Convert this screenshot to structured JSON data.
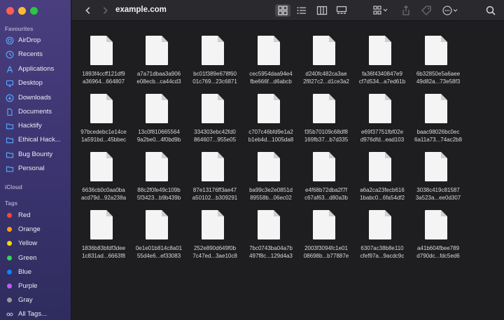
{
  "window": {
    "title": "example.com",
    "back_icon": "chevron-left-icon",
    "forward_icon": "chevron-right-icon"
  },
  "toolbar": {
    "icons": [
      "grid-view-icon",
      "list-view-icon",
      "column-view-icon",
      "gallery-view-icon",
      "group-icon",
      "share-icon",
      "tag-icon",
      "more-icon",
      "search-icon"
    ]
  },
  "sidebar": {
    "favourites_label": "Favourites",
    "favourites": [
      {
        "label": "AirDrop",
        "icon": "airdrop-icon"
      },
      {
        "label": "Recents",
        "icon": "clock-icon"
      },
      {
        "label": "Applications",
        "icon": "applications-icon"
      },
      {
        "label": "Desktop",
        "icon": "desktop-icon"
      },
      {
        "label": "Downloads",
        "icon": "download-icon"
      },
      {
        "label": "Documents",
        "icon": "document-icon"
      },
      {
        "label": "Hacktify",
        "icon": "folder-icon"
      },
      {
        "label": "Ethical Hack...",
        "icon": "folder-icon"
      },
      {
        "label": "Bug Bounty",
        "icon": "folder-icon"
      },
      {
        "label": "Personal",
        "icon": "folder-icon"
      }
    ],
    "icloud_label": "iCloud",
    "tags_label": "Tags",
    "tags": [
      {
        "label": "Red",
        "color": "#ff453a"
      },
      {
        "label": "Orange",
        "color": "#ff9f0a"
      },
      {
        "label": "Yellow",
        "color": "#ffd60a"
      },
      {
        "label": "Green",
        "color": "#32d74b"
      },
      {
        "label": "Blue",
        "color": "#0a84ff"
      },
      {
        "label": "Purple",
        "color": "#bf5af2"
      },
      {
        "label": "Gray",
        "color": "#98989d"
      },
      {
        "label": "All Tags...",
        "color": ""
      }
    ]
  },
  "files": [
    {
      "line1": "1893f4ccff121df9",
      "line2": "a36964...664807"
    },
    {
      "line1": "a7a71dbaa3a906",
      "line2": "e08ecb...ca44cd3"
    },
    {
      "line1": "bc01f389e678f60",
      "line2": "01c769...23c6871"
    },
    {
      "line1": "cec5954daa94e4",
      "line2": "fbe666f...d6abcb"
    },
    {
      "line1": "d240fc482ca3ae",
      "line2": "2f827c2...d1ce3a2"
    },
    {
      "line1": "fa36f4340847e9",
      "line2": "cf7d534...a7ed61b"
    },
    {
      "line1": "6b32850e5a6aee",
      "line2": "49d82a...73e58f3"
    },
    {
      "line1": "97bcedebc1e14ce",
      "line2": "1a591bd...45bbec"
    },
    {
      "line1": "13c0f810665564",
      "line2": "9a2be0...4f0bd9b"
    },
    {
      "line1": "334303ebc42fd0",
      "line2": "864607...955e05"
    },
    {
      "line1": "c707c46bfd9e1a2",
      "line2": "b1eb4d...1005da8"
    },
    {
      "line1": "f35b70109c68df8",
      "line2": "169fb37...b7d335"
    },
    {
      "line1": "e69f37751fbf02e",
      "line2": "d976dfd...ead103"
    },
    {
      "line1": "baac98026bc0ec",
      "line2": "6a11a73...74ac2b8"
    },
    {
      "line1": "6636cb0c0aa0ba",
      "line2": "acd79d...92a238a"
    },
    {
      "line1": "88c2f0fe49c109b",
      "line2": "5f3423...b9b439b"
    },
    {
      "line1": "87e13176ff3ae47",
      "line2": "a50102...b309291"
    },
    {
      "line1": "ba99c3e2e0851d",
      "line2": "89558b...06ec02"
    },
    {
      "line1": "e4f68b72dba2f7f",
      "line2": "c67af63...d80a3b"
    },
    {
      "line1": "a6a2ca23fecb616",
      "line2": "1babc0...6fa54df2"
    },
    {
      "line1": "3038c419c81587",
      "line2": "3a523a...ee0d307"
    },
    {
      "line1": "1836b83bfdf3dee",
      "line2": "1c831ad...6663f8"
    },
    {
      "line1": "0e1e01b814c8a01",
      "line2": "55d4e6...ef33083"
    },
    {
      "line1": "252e890d649f0b",
      "line2": "7c47ed...3ae10c8"
    },
    {
      "line1": "7bc0743ba04a7b",
      "line2": "497f8c...129d4a3"
    },
    {
      "line1": "2003f3094fc1e01",
      "line2": "08698b...b77887e"
    },
    {
      "line1": "6307ac38b8e110",
      "line2": "cfef97a...9acdc9c"
    },
    {
      "line1": "a41b604fbee789",
      "line2": "d790dc...fdc5ed6"
    }
  ]
}
